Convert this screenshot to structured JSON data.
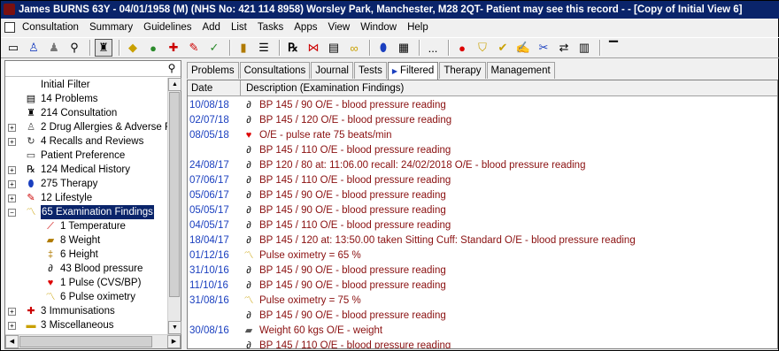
{
  "window": {
    "title": "James BURNS 63Y - 04/01/1958 (M) (NHS No: 421 114 8958)  Worsley Park, Manchester, M28 2QT- Patient may see this record - - [Copy of Initial View 6]"
  },
  "menu": [
    "Consultation",
    "Summary",
    "Guidelines",
    "Add",
    "List",
    "Tasks",
    "Apps",
    "View",
    "Window",
    "Help"
  ],
  "toolbar": {
    "icons": [
      "screen-icon",
      "person-icon",
      "group-icon",
      "find-icon",
      "consultation-icon",
      "tag-icon",
      "apple-icon",
      "add-icon",
      "pin-icon",
      "needle-icon",
      "notebook-icon",
      "list-icon",
      "rx-icon",
      "bowtie-icon",
      "register-icon",
      "ribbon-icon",
      "pill-icon",
      "clipboard-icon",
      "more-icon",
      "stop-icon",
      "filter-icon",
      "check-icon",
      "edit-icon",
      "scissors-icon",
      "swap-icon",
      "film-icon",
      "document-icon"
    ],
    "more_label": "..."
  },
  "tree": [
    {
      "label": "Initial Filter",
      "icon": "",
      "expander": "",
      "level": 0
    },
    {
      "label": "14 Problems",
      "icon": "problems-icon",
      "expander": "",
      "level": 0
    },
    {
      "label": "214 Consultation",
      "icon": "consultation-icon",
      "expander": "",
      "level": 0
    },
    {
      "label": "2 Drug Allergies & Adverse Re",
      "icon": "allergy-icon",
      "expander": "+",
      "level": 0
    },
    {
      "label": "4 Recalls and Reviews",
      "icon": "recall-icon",
      "expander": "+",
      "level": 0
    },
    {
      "label": "Patient Preference",
      "icon": "preference-icon",
      "expander": "",
      "level": 0
    },
    {
      "label": "124 Medical History",
      "icon": "history-icon",
      "expander": "+",
      "level": 0
    },
    {
      "label": "275 Therapy",
      "icon": "therapy-icon",
      "expander": "+",
      "level": 0
    },
    {
      "label": "12 Lifestyle",
      "icon": "lifestyle-icon",
      "expander": "+",
      "level": 0
    },
    {
      "label": "65 Examination Findings",
      "icon": "examination-icon",
      "expander": "−",
      "level": 0,
      "selected": true
    },
    {
      "label": "1 Temperature",
      "icon": "thermometer-icon",
      "expander": "",
      "level": 1
    },
    {
      "label": "8 Weight",
      "icon": "weight-icon",
      "expander": "",
      "level": 1
    },
    {
      "label": "6 Height",
      "icon": "height-icon",
      "expander": "",
      "level": 1
    },
    {
      "label": "43 Blood pressure",
      "icon": "bp-icon",
      "expander": "",
      "level": 1
    },
    {
      "label": "1 Pulse (CVS/BP)",
      "icon": "heart-icon",
      "expander": "",
      "level": 1
    },
    {
      "label": "6 Pulse oximetry",
      "icon": "chart-icon",
      "expander": "",
      "level": 1
    },
    {
      "label": "3 Immunisations",
      "icon": "immunisation-icon",
      "expander": "+",
      "level": 0
    },
    {
      "label": "3 Miscellaneous",
      "icon": "folder-icon",
      "expander": "+",
      "level": 0
    }
  ],
  "tabs": [
    {
      "label": "Problems",
      "active": false
    },
    {
      "label": "Consultations",
      "active": false
    },
    {
      "label": "Journal",
      "active": false
    },
    {
      "label": "Tests",
      "active": false
    },
    {
      "label": "Filtered",
      "active": true,
      "arrow": "▶"
    },
    {
      "label": "Therapy",
      "active": false
    },
    {
      "label": "Management",
      "active": false
    }
  ],
  "grid": {
    "columns": [
      "Date",
      "Description (Examination Findings)"
    ],
    "rows": [
      {
        "date": "10/08/18",
        "icon": "bp",
        "text": "BP 145 / 90   O/E - blood pressure reading"
      },
      {
        "date": "02/07/18",
        "icon": "bp",
        "text": "BP 145 / 120   O/E - blood pressure reading"
      },
      {
        "date": "08/05/18",
        "icon": "heart",
        "text": "O/E - pulse rate   75 beats/min"
      },
      {
        "date": "",
        "icon": "bp",
        "text": "BP 145 / 110   O/E - blood pressure reading"
      },
      {
        "date": "24/08/17",
        "icon": "bp",
        "text": "BP 120 / 80   at: 11:06.00   recall:  24/02/2018    O/E - blood pressure reading"
      },
      {
        "date": "07/06/17",
        "icon": "bp",
        "text": "BP 145 / 110   O/E - blood pressure reading"
      },
      {
        "date": "05/06/17",
        "icon": "bp",
        "text": "BP 145 / 90   O/E - blood pressure reading"
      },
      {
        "date": "05/05/17",
        "icon": "bp",
        "text": "BP 145 / 90   O/E - blood pressure reading"
      },
      {
        "date": "04/05/17",
        "icon": "bp",
        "text": "BP 145 / 110   O/E - blood pressure reading"
      },
      {
        "date": "18/04/17",
        "icon": "bp",
        "text": "BP 145 / 120   at: 13:50.00 taken  Sitting  Cuff:  Standard    O/E - blood pressure reading"
      },
      {
        "date": "01/12/16",
        "icon": "chart",
        "text": "Pulse oximetry = 65 %"
      },
      {
        "date": "31/10/16",
        "icon": "bp",
        "text": "BP 145 / 90   O/E - blood pressure reading"
      },
      {
        "date": "11/10/16",
        "icon": "bp",
        "text": "BP 145 / 90   O/E - blood pressure reading"
      },
      {
        "date": "31/08/16",
        "icon": "chart",
        "text": "Pulse oximetry = 75 %"
      },
      {
        "date": "",
        "icon": "bp",
        "text": "BP 145 / 90   O/E - blood pressure reading"
      },
      {
        "date": "30/08/16",
        "icon": "weight",
        "text": "Weight 60 kgs   O/E - weight"
      },
      {
        "date": "",
        "icon": "bp",
        "text": "BP 145 / 110   O/E - blood pressure reading"
      }
    ]
  }
}
